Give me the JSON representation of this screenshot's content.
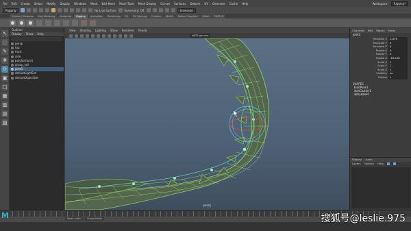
{
  "menubar": {
    "items": [
      "File",
      "Edit",
      "Create",
      "Select",
      "Modify",
      "Display",
      "Windows",
      "Mesh",
      "Edit Mesh",
      "Mesh Tools",
      "Mesh Display",
      "Curves",
      "Surfaces",
      "Deform",
      "UV",
      "Generate",
      "Cache",
      "Help"
    ],
    "workspace_label": "Workspace:",
    "workspace_value": "Rigging*"
  },
  "statusline": {
    "mode": "Rigging",
    "live_surface": "No Live Surface",
    "symmetry": "Symmetry: Off",
    "search_placeholder": "browsebe"
  },
  "shelf_tabs": [
    "Curves / Surfaces",
    "Poly Modeling",
    "Sculpting",
    "Rigging",
    "Animation",
    "Rendering",
    "FX",
    "FX Caching",
    "Custom",
    "MASH",
    "Motion Graphics",
    "XGen",
    "TURTLE"
  ],
  "shelf_active": "Rigging",
  "outliner": {
    "title": "Outliner",
    "menu": [
      "Display",
      "Show",
      "Help"
    ],
    "items": [
      {
        "label": "persp",
        "selected": false
      },
      {
        "label": "top",
        "selected": false
      },
      {
        "label": "front",
        "selected": false
      },
      {
        "label": "side",
        "selected": false
      },
      {
        "label": "polySurface1",
        "selected": false
      },
      {
        "label": "group_tail",
        "selected": false
      },
      {
        "label": "joint1",
        "selected": true
      },
      {
        "label": "defaultLightSet",
        "selected": false
      },
      {
        "label": "defaultObjectSet",
        "selected": false
      }
    ]
  },
  "viewport": {
    "menu": [
      "View",
      "Shading",
      "Lighting",
      "Show",
      "Renderer",
      "Panels"
    ],
    "colorspace": "sRGB gamma",
    "camera_label": "persp"
  },
  "channelbox": {
    "tabs": [
      "Channels",
      "Edit",
      "Object",
      "Show"
    ],
    "node": "joint3",
    "attributes": [
      {
        "name": "Translate X",
        "value": "3.876"
      },
      {
        "name": "Translate Y",
        "value": "0"
      },
      {
        "name": "Translate Z",
        "value": "0"
      },
      {
        "name": "Rotate X",
        "value": "0"
      },
      {
        "name": "Rotate Y",
        "value": "0"
      },
      {
        "name": "Rotate Z",
        "value": "-18.228"
      },
      {
        "name": "Scale X",
        "value": "1"
      },
      {
        "name": "Scale Y",
        "value": "1"
      },
      {
        "name": "Scale Z",
        "value": "1"
      },
      {
        "name": "Visibility",
        "value": "on"
      },
      {
        "name": "Radius",
        "value": "1"
      }
    ],
    "shapes_header": "SHAPES",
    "shapes": [
      "bindPose1",
      "skinCluster1",
      "dollyHook1"
    ],
    "layers_tabs": [
      "Display",
      "Anim"
    ],
    "layers_menu": [
      "Layers",
      "Options",
      "Help"
    ]
  },
  "bottom": {
    "tabs": [
      "Mode Editor",
      "Shape Editor"
    ]
  },
  "watermark": "搜狐号@leslie.975",
  "colors": {
    "accent": "#5285a6",
    "mesh": "#8fd16a",
    "bg": "#444444"
  }
}
